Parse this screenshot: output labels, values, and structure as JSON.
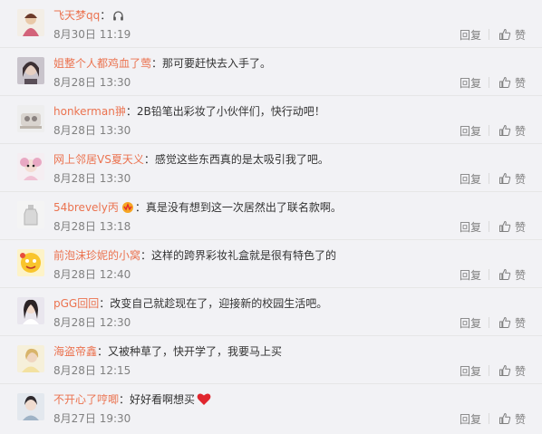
{
  "comments": [
    {
      "user": "飞天梦qq",
      "text": "",
      "time": "8月30日 11:19",
      "reply": "回复",
      "like": "赞",
      "icon": "headphone-icon"
    },
    {
      "user": "姐整个人都鸡血了莺",
      "text": "那可要赶快去入手了。",
      "time": "8月28日 13:30",
      "reply": "回复",
      "like": "赞"
    },
    {
      "user": "honkerman翀",
      "text": "2B铅笔出彩妆了小伙伴们，快行动吧！",
      "time": "8月28日 13:30",
      "reply": "回复",
      "like": "赞"
    },
    {
      "user": "网上邻居VS夏天义",
      "text": "感觉这些东西真的是太吸引我了吧。",
      "time": "8月28日 13:30",
      "reply": "回复",
      "like": "赞"
    },
    {
      "user": "54brevely丙",
      "text": "真是没有想到这一次居然出了联名款啊。",
      "time": "8月28日 13:18",
      "reply": "回复",
      "like": "赞",
      "icon": "vip-badge-icon"
    },
    {
      "user": "前泡沫珍妮的小窝",
      "text": "这样的跨界彩妆礼盒就是很有特色了的",
      "time": "8月28日 12:40",
      "reply": "回复",
      "like": "赞"
    },
    {
      "user": "pGG回回",
      "text": "改变自己就趁现在了，迎接新的校园生活吧。",
      "time": "8月28日 12:30",
      "reply": "回复",
      "like": "赞"
    },
    {
      "user": "海盗帝鑫",
      "text": "又被种草了，快开学了，我要马上买",
      "time": "8月28日 12:15",
      "reply": "回复",
      "like": "赞"
    },
    {
      "user": "不开心了哼唧",
      "text": "好好看啊想买",
      "time": "8月27日 19:30",
      "reply": "回复",
      "like": "赞",
      "emoji": "heart-emoji-icon"
    }
  ],
  "colors": {
    "username": "#eb7350",
    "meta": "#808080",
    "heart": "#e0262e"
  }
}
